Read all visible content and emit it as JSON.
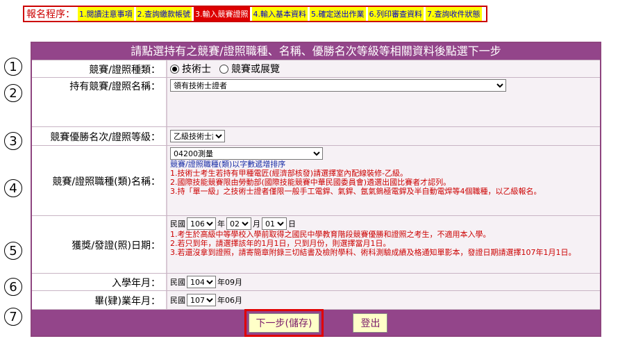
{
  "steps": {
    "title": "報名程序：",
    "items": [
      "1.閱讀注意事項",
      "2.查詢繳款帳號",
      "3.輸入競賽證照",
      "4.輸入基本資料",
      "5.確定送出作業",
      "6.列印審查資料",
      "7.查詢收件狀態"
    ],
    "current_index": 2
  },
  "form": {
    "header": "請點選持有之競賽/證照職種、名稱、優勝名次等級等相關資料後點選下一步",
    "type": {
      "label": "競賽/證照種類：",
      "option1": "技術士",
      "option2": "競賽或展覽",
      "selected": "技術士"
    },
    "name": {
      "label": "持有競賽/證照名稱：",
      "value": "領有技術士證者"
    },
    "level": {
      "label": "競賽優勝名次/證照等級：",
      "value": "乙級技術士證"
    },
    "trade": {
      "label": "競賽/證照職種(類)名稱：",
      "value": "04200測量",
      "sort_note": "競賽/證照職種(類)以字數遞增排序",
      "note1": "1.技術士考生若持有甲種電匠(經濟部核發)請選擇室內配線裝修-乙級。",
      "note2": "2.國際技能競賽限由勞動部(國際技能競賽中華民國委員會)遴選出國比賽者才認列。",
      "note3": "3.持「單一級」之技術士證者僅限一般手工電銲、氣銲、氬氣鎢極電銲及半自動電焊等4個職種，以乙級報名。"
    },
    "award_date": {
      "label": "獲獎/發證(照)日期：",
      "era": "民國",
      "year": "106",
      "year_unit": "年",
      "month": "02",
      "month_unit": "月",
      "day": "01",
      "day_unit": "日",
      "note1": "1.考生於高級中等學校入學前取得之國民中學教育階段競賽優勝和證照之考生，不適用本入學。",
      "note2": "2.若只到年，請選擇該年的1月1日，只到月份，則選擇當月1日。",
      "note3": "3.若還沒拿到證照，請寄簡章附錄三切結書及檢附學科、術科測驗成績及格通知單影本，發證日期請選擇107年1月1日。"
    },
    "enroll": {
      "label": "入學年月：",
      "era": "民國",
      "year": "104",
      "suffix": "年09月"
    },
    "graduate": {
      "label": "畢(肄)業年月：",
      "era": "民國",
      "year": "107",
      "suffix": "年06月"
    },
    "buttons": {
      "next": "下一步(儲存)",
      "logout": "登出"
    }
  },
  "row_numbers": [
    "1",
    "2",
    "3",
    "4",
    "5",
    "6",
    "7"
  ],
  "colors": {
    "header_purple": "#93458a",
    "step_yellow": "#ffff00",
    "step_current": "#dd0000",
    "note_red": "#cc0000",
    "note_blue": "#1a2fa8"
  }
}
